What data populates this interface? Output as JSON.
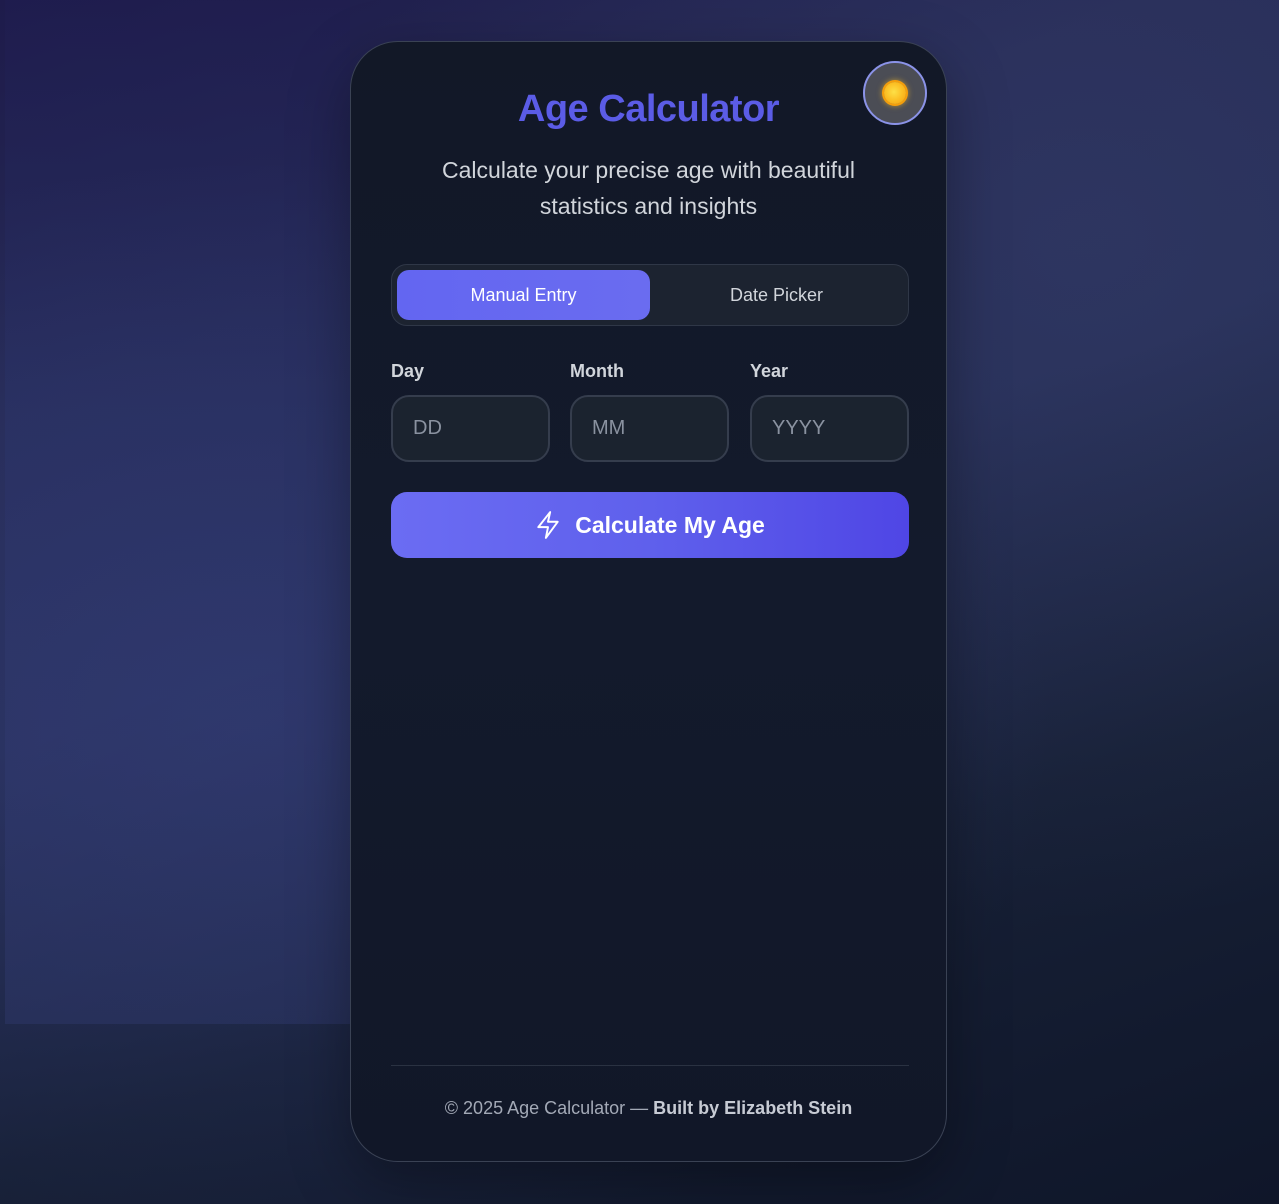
{
  "app": {
    "title": "Age Calculator",
    "subtitle": "Calculate your precise age with beautiful statistics and insights"
  },
  "theme_toggle": {
    "icon": "sun-icon"
  },
  "tabs": [
    {
      "label": "Manual Entry",
      "active": true
    },
    {
      "label": "Date Picker",
      "active": false
    }
  ],
  "fields": {
    "day": {
      "label": "Day",
      "placeholder": "DD",
      "value": ""
    },
    "month": {
      "label": "Month",
      "placeholder": "MM",
      "value": ""
    },
    "year": {
      "label": "Year",
      "placeholder": "YYYY",
      "value": ""
    }
  },
  "calculate_button": {
    "label": "Calculate My Age",
    "icon": "lightning-icon"
  },
  "footer": {
    "text": "© 2025 Age Calculator — ",
    "author": "Built by Elizabeth Stein"
  },
  "colors": {
    "accent": "#6366f1",
    "title": "#5b5ce6",
    "card_bg": "#121827"
  }
}
